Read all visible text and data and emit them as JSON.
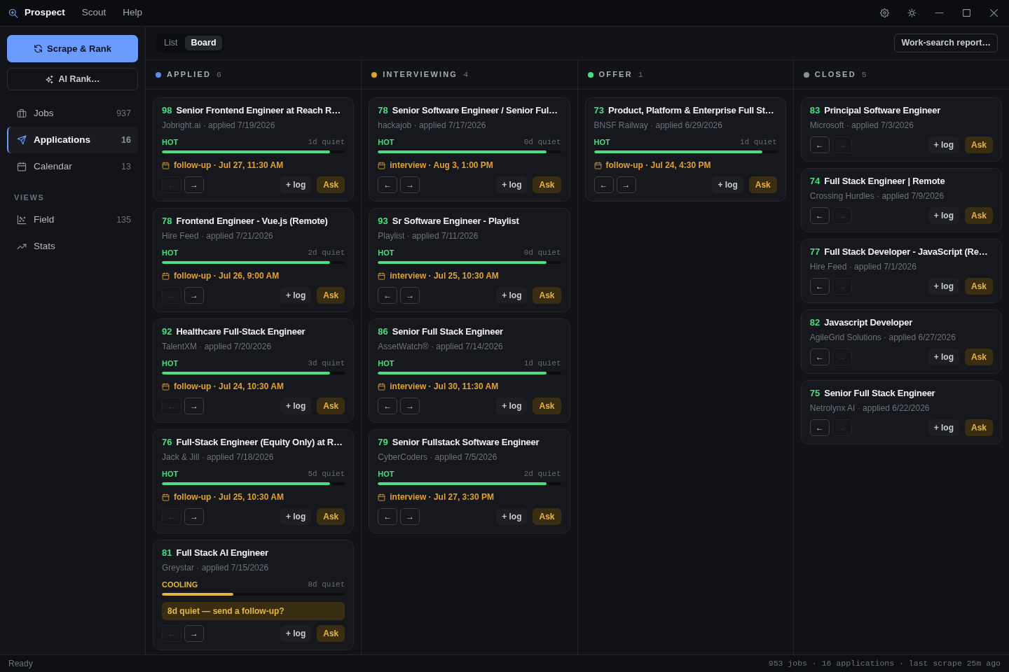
{
  "app": {
    "name": "Prospect",
    "menu": [
      "Scout",
      "Help"
    ]
  },
  "sidebar": {
    "primary_action": "Scrape & Rank",
    "secondary_action": "AI Rank…",
    "items": [
      {
        "label": "Jobs",
        "count": "937",
        "selected": false
      },
      {
        "label": "Applications",
        "count": "16",
        "selected": true
      },
      {
        "label": "Calendar",
        "count": "13",
        "selected": false
      }
    ],
    "section_label": "VIEWS",
    "views": [
      {
        "label": "Field",
        "count": "135",
        "selected": false
      },
      {
        "label": "Stats",
        "selected": false
      }
    ]
  },
  "toolbar": {
    "view_tabs": [
      {
        "label": "List",
        "selected": false
      },
      {
        "label": "Board",
        "selected": true
      }
    ],
    "report_button": "Work-search report…"
  },
  "board": {
    "columns": [
      {
        "title": "APPLIED",
        "count": "6",
        "color": "#5b8def",
        "cards": [
          {
            "score": "98",
            "title": "Senior Frontend Engineer at Reach R…",
            "meta": "Jobright.ai · applied 7/19/2026",
            "heat": {
              "kind": "hot",
              "label": "HOT",
              "level": 0.92
            },
            "quiet": "1d quiet",
            "event": "follow-up · Jul 27, 11:30 AM",
            "nav": [
              {
                "label": "←",
                "disabled": true
              },
              {
                "label": "→",
                "disabled": false
              }
            ],
            "actions": [
              "+ log",
              "Ask"
            ]
          },
          {
            "score": "78",
            "title": "Frontend Engineer - Vue.js (Remote)",
            "meta": "Hire Feed · applied 7/21/2026",
            "heat": {
              "kind": "hot",
              "label": "HOT",
              "level": 0.92
            },
            "quiet": "2d quiet",
            "event": "follow-up · Jul 26, 9:00 AM",
            "nav": [
              {
                "label": "←",
                "disabled": true
              },
              {
                "label": "→",
                "disabled": false
              }
            ],
            "actions": [
              "+ log",
              "Ask"
            ]
          },
          {
            "score": "92",
            "title": "Healthcare Full-Stack Engineer",
            "meta": "TalentXM · applied 7/20/2026",
            "heat": {
              "kind": "hot",
              "label": "HOT",
              "level": 0.92
            },
            "quiet": "3d quiet",
            "event": "follow-up · Jul 24, 10:30 AM",
            "nav": [
              {
                "label": "←",
                "disabled": true
              },
              {
                "label": "→",
                "disabled": false
              }
            ],
            "actions": [
              "+ log",
              "Ask"
            ]
          },
          {
            "score": "76",
            "title": "Full-Stack Engineer (Equity Only) at R…",
            "meta": "Jack & Jill · applied 7/18/2026",
            "heat": {
              "kind": "hot",
              "label": "HOT",
              "level": 0.92
            },
            "quiet": "5d quiet",
            "event": "follow-up · Jul 25, 10:30 AM",
            "nav": [
              {
                "label": "←",
                "disabled": true
              },
              {
                "label": "→",
                "disabled": false
              }
            ],
            "actions": [
              "+ log",
              "Ask"
            ]
          },
          {
            "score": "81",
            "title": "Full Stack AI Engineer",
            "meta": "Greystar · applied 7/15/2026",
            "heat": {
              "kind": "cooling",
              "label": "COOLING",
              "level": 0.39
            },
            "quiet": "8d quiet",
            "nudge": "8d quiet — send a follow-up?",
            "nav": [
              {
                "label": "←",
                "disabled": true
              },
              {
                "label": "→",
                "disabled": false
              }
            ],
            "actions": [
              "+ log",
              "Ask"
            ]
          }
        ]
      },
      {
        "title": "INTERVIEWING",
        "count": "4",
        "color": "#e0a030",
        "cards": [
          {
            "score": "78",
            "title": "Senior Software Engineer / Senior Ful…",
            "meta": "hackajob · applied 7/17/2026",
            "heat": {
              "kind": "hot",
              "label": "HOT",
              "level": 0.92
            },
            "quiet": "0d quiet",
            "event": "interview · Aug 3, 1:00 PM",
            "nav": [
              {
                "label": "←",
                "disabled": false
              },
              {
                "label": "→",
                "disabled": false
              }
            ],
            "actions": [
              "+ log",
              "Ask"
            ]
          },
          {
            "score": "93",
            "title": "Sr Software Engineer - Playlist",
            "meta": "Playlist · applied 7/11/2026",
            "heat": {
              "kind": "hot",
              "label": "HOT",
              "level": 0.92
            },
            "quiet": "0d quiet",
            "event": "interview · Jul 25, 10:30 AM",
            "nav": [
              {
                "label": "←",
                "disabled": false
              },
              {
                "label": "→",
                "disabled": false
              }
            ],
            "actions": [
              "+ log",
              "Ask"
            ]
          },
          {
            "score": "86",
            "title": "Senior Full Stack Engineer",
            "meta": "AssetWatch® · applied 7/14/2026",
            "heat": {
              "kind": "hot",
              "label": "HOT",
              "level": 0.92
            },
            "quiet": "1d quiet",
            "event": "interview · Jul 30, 11:30 AM",
            "nav": [
              {
                "label": "←",
                "disabled": false
              },
              {
                "label": "→",
                "disabled": false
              }
            ],
            "actions": [
              "+ log",
              "Ask"
            ]
          },
          {
            "score": "79",
            "title": "Senior Fullstack Software Engineer",
            "meta": "CyberCoders · applied 7/5/2026",
            "heat": {
              "kind": "hot",
              "label": "HOT",
              "level": 0.92
            },
            "quiet": "2d quiet",
            "event": "interview · Jul 27, 3:30 PM",
            "nav": [
              {
                "label": "←",
                "disabled": false
              },
              {
                "label": "→",
                "disabled": false
              }
            ],
            "actions": [
              "+ log",
              "Ask"
            ]
          }
        ]
      },
      {
        "title": "OFFER",
        "count": "1",
        "color": "#4ade80",
        "cards": [
          {
            "score": "73",
            "title": "Product, Platform & Enterprise Full St…",
            "meta": "BNSF Railway · applied 6/29/2026",
            "heat": {
              "kind": "hot",
              "label": "HOT",
              "level": 0.92
            },
            "quiet": "1d quiet",
            "event": "follow-up · Jul 24, 4:30 PM",
            "nav": [
              {
                "label": "←",
                "disabled": false
              },
              {
                "label": "→",
                "disabled": false
              }
            ],
            "actions": [
              "+ log",
              "Ask"
            ]
          }
        ]
      },
      {
        "title": "CLOSED",
        "count": "5",
        "color": "#8a9099",
        "cards": [
          {
            "score": "83",
            "title": "Principal Software Engineer",
            "meta": "Microsoft · applied 7/3/2026",
            "nav": [
              {
                "label": "←",
                "disabled": false
              },
              {
                "label": "→",
                "disabled": true
              }
            ],
            "actions": [
              "+ log",
              "Ask"
            ]
          },
          {
            "score": "74",
            "title": "Full Stack Engineer | Remote",
            "meta": "Crossing Hurdles · applied 7/9/2026",
            "nav": [
              {
                "label": "←",
                "disabled": false
              },
              {
                "label": "→",
                "disabled": true
              }
            ],
            "actions": [
              "+ log",
              "Ask"
            ]
          },
          {
            "score": "77",
            "title": "Full Stack Developer - JavaScript (Re…",
            "meta": "Hire Feed · applied 7/1/2026",
            "nav": [
              {
                "label": "←",
                "disabled": false
              },
              {
                "label": "→",
                "disabled": true
              }
            ],
            "actions": [
              "+ log",
              "Ask"
            ]
          },
          {
            "score": "82",
            "title": "Javascript Developer",
            "meta": "AgileGrid Solutions · applied 6/27/2026",
            "nav": [
              {
                "label": "←",
                "disabled": false
              },
              {
                "label": "→",
                "disabled": true
              }
            ],
            "actions": [
              "+ log",
              "Ask"
            ]
          },
          {
            "score": "75",
            "title": "Senior Full Stack Engineer",
            "meta": "Netrolynx AI · applied 6/22/2026",
            "nav": [
              {
                "label": "←",
                "disabled": false
              },
              {
                "label": "→",
                "disabled": true
              }
            ],
            "actions": [
              "+ log",
              "Ask"
            ]
          }
        ]
      }
    ]
  },
  "status_bar": {
    "left": "Ready",
    "right": "953 jobs · 16 applications · last scrape 25m ago"
  }
}
